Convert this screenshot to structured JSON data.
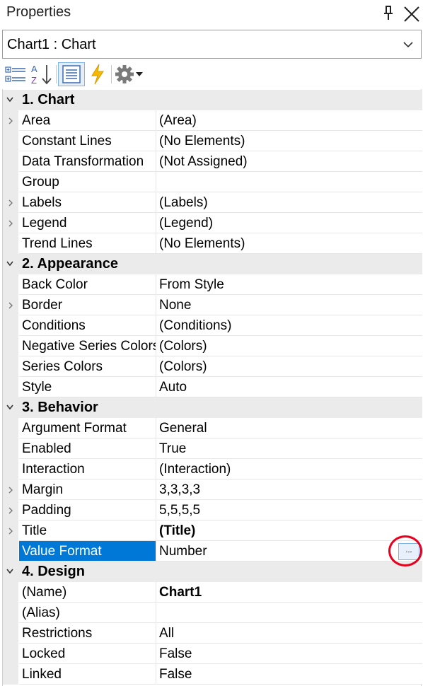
{
  "panel": {
    "title": "Properties",
    "selector": "Chart1 : Chart"
  },
  "toolbar": {
    "buttons": [
      {
        "name": "categorized-icon"
      },
      {
        "name": "alphabetical-sort-icon"
      },
      {
        "name": "properties-icon"
      },
      {
        "name": "events-lightning-icon"
      },
      {
        "name": "settings-gear-icon"
      }
    ]
  },
  "categories": [
    {
      "label": "1. Chart"
    },
    {
      "label": "2. Appearance"
    },
    {
      "label": "3. Behavior"
    },
    {
      "label": "4. Design"
    }
  ],
  "properties": {
    "chart": [
      {
        "name": "Area",
        "value": "(Area)",
        "expandable": true
      },
      {
        "name": "Constant Lines",
        "value": "(No Elements)",
        "expandable": false
      },
      {
        "name": "Data Transformation",
        "value": "(Not Assigned)",
        "expandable": false
      },
      {
        "name": "Group",
        "value": "",
        "expandable": false
      },
      {
        "name": "Labels",
        "value": "(Labels)",
        "expandable": true
      },
      {
        "name": "Legend",
        "value": "(Legend)",
        "expandable": true
      },
      {
        "name": "Trend Lines",
        "value": "(No Elements)",
        "expandable": false
      }
    ],
    "appearance": [
      {
        "name": "Back Color",
        "value": "From Style",
        "expandable": false
      },
      {
        "name": "Border",
        "value": "None",
        "expandable": true
      },
      {
        "name": "Conditions",
        "value": "(Conditions)",
        "expandable": false
      },
      {
        "name": "Negative Series Colors",
        "value": "(Colors)",
        "expandable": false
      },
      {
        "name": "Series Colors",
        "value": "(Colors)",
        "expandable": false
      },
      {
        "name": "Style",
        "value": "Auto",
        "expandable": false
      }
    ],
    "behavior": [
      {
        "name": "Argument Format",
        "value": "General",
        "expandable": false
      },
      {
        "name": "Enabled",
        "value": "True",
        "expandable": false
      },
      {
        "name": "Interaction",
        "value": "(Interaction)",
        "expandable": false
      },
      {
        "name": "Margin",
        "value": "3,3,3,3",
        "expandable": true
      },
      {
        "name": "Padding",
        "value": "5,5,5,5",
        "expandable": true
      },
      {
        "name": "Title",
        "value": "(Title)",
        "expandable": true,
        "bold": true
      },
      {
        "name": "Value Format",
        "value": "Number",
        "expandable": false,
        "selected": true
      }
    ],
    "design": [
      {
        "name": "(Name)",
        "value": "Chart1",
        "expandable": false,
        "bold": true
      },
      {
        "name": "(Alias)",
        "value": "",
        "expandable": false
      },
      {
        "name": "Restrictions",
        "value": "All",
        "expandable": false
      },
      {
        "name": "Locked",
        "value": "False",
        "expandable": false
      },
      {
        "name": "Linked",
        "value": "False",
        "expandable": false
      }
    ]
  },
  "ellipsis_button": "...",
  "colors": {
    "selection": "#0078d7",
    "category_background": "#ebebeb",
    "highlight": "#e8001c",
    "lightning": "#f5b800"
  }
}
